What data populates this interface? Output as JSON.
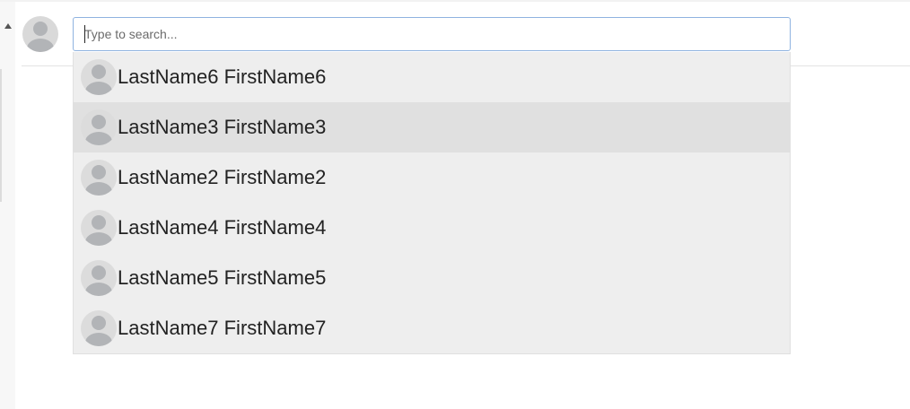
{
  "search": {
    "placeholder": "Type to search..."
  },
  "dropdown": {
    "highlighted_index": 1,
    "options": [
      {
        "label": "LastName6 FirstName6"
      },
      {
        "label": "LastName3 FirstName3"
      },
      {
        "label": "LastName2 FirstName2"
      },
      {
        "label": "LastName4 FirstName4"
      },
      {
        "label": "LastName5 FirstName5"
      },
      {
        "label": "LastName7 FirstName7"
      }
    ]
  },
  "icons": {
    "collapse": "triangle-up-icon",
    "user": "user-avatar-icon"
  },
  "colors": {
    "input_border": "#8fb3e0",
    "dropdown_bg": "#eeeeee",
    "highlight_bg": "#e0e0e0",
    "avatar_silhouette": "#b2b4b7"
  }
}
